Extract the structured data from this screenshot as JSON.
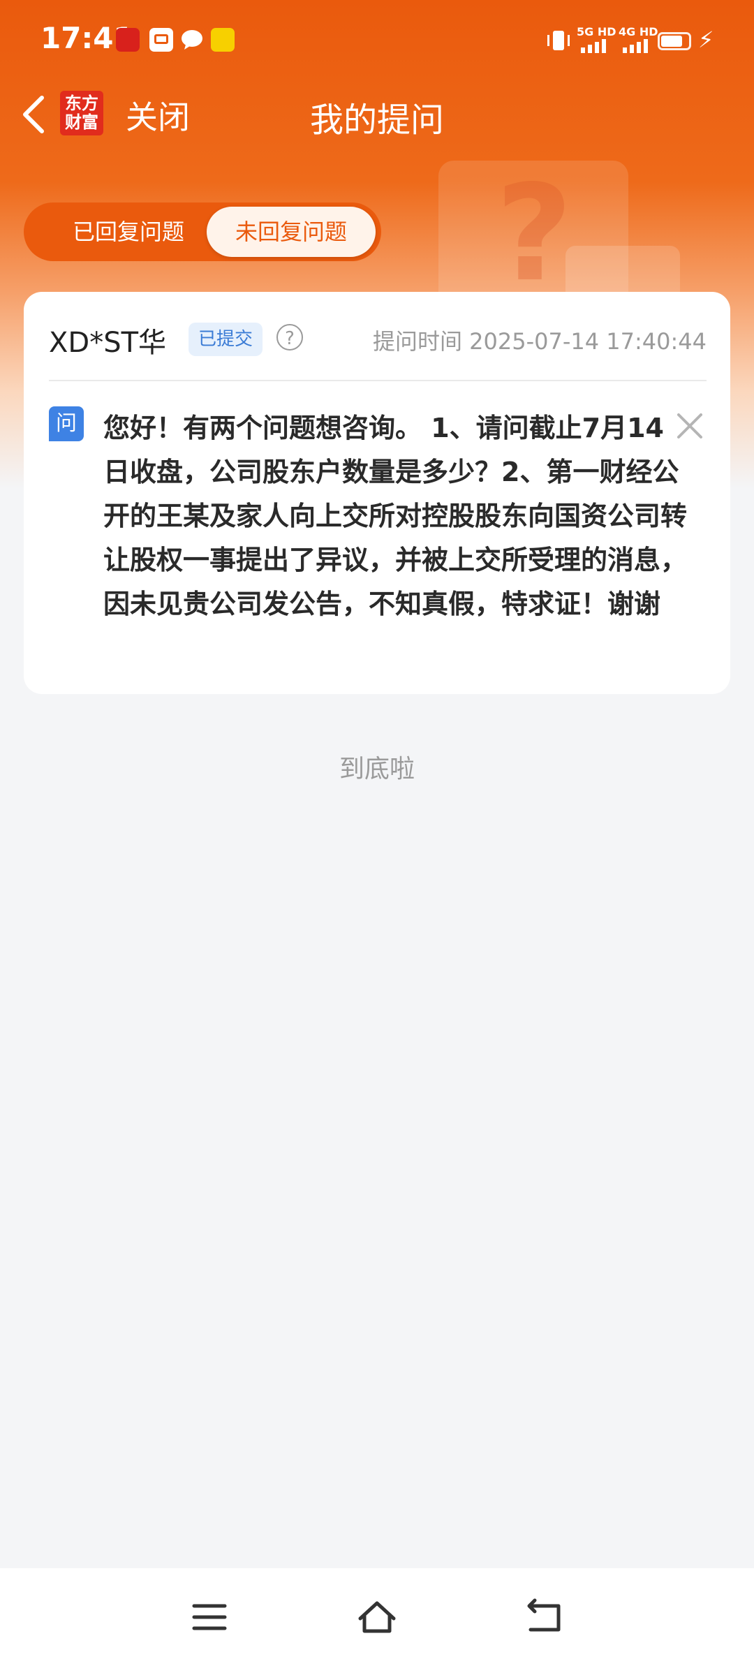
{
  "status_bar": {
    "time": "17:41",
    "network1": "5G HD",
    "network2": "4G HD"
  },
  "nav": {
    "logo_line1": "东方",
    "logo_line2": "财富",
    "close_label": "关闭",
    "title": "我的提问"
  },
  "tabs": [
    {
      "label": "已回复问题",
      "active": false
    },
    {
      "label": "未回复问题",
      "active": true
    }
  ],
  "question_card": {
    "company": "XD*ST华",
    "status_badge": "已提交",
    "time_label": "提问时间 2025-07-14 17:40:44",
    "tag": "问",
    "question": "您好！有两个问题想咨询。 1、请问截止7月14日收盘，公司股东户数量是多少？2、第一财经公开的王某及家人向上交所对控股股东向国资公司转让股权一事提出了异议，并被上交所受理的消息，因未见贵公司发公告，不知真假，特求证！谢谢"
  },
  "end_text": "到底啦",
  "colors": {
    "accent": "#ea5a0d",
    "badge_blue": "#3a7bd5"
  }
}
